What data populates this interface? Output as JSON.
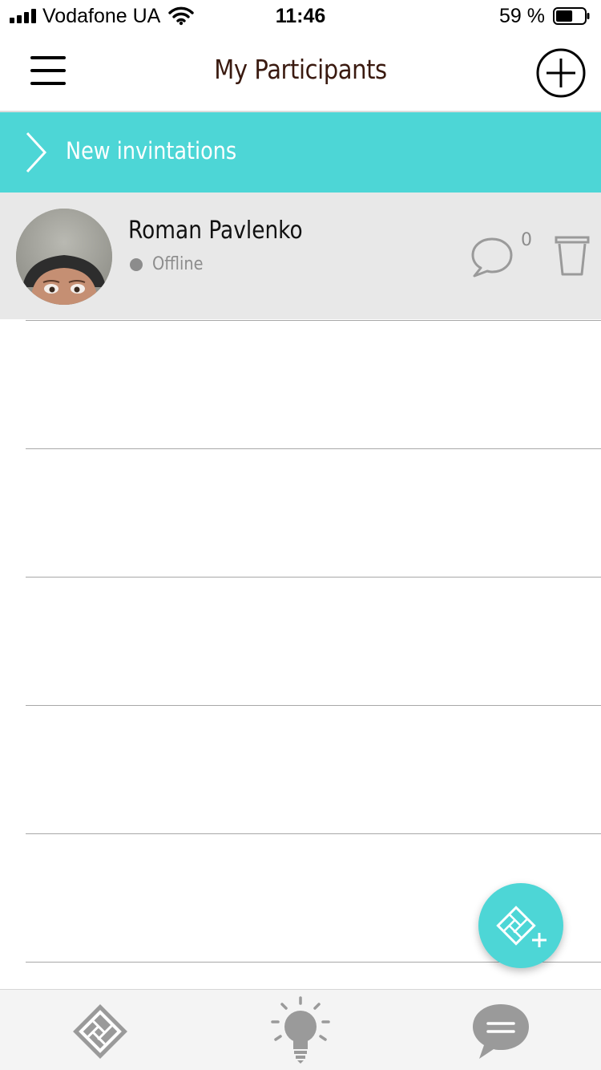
{
  "status_bar": {
    "carrier": "Vodafone UA",
    "time": "11:46",
    "battery_percent": "59 %",
    "battery_level": 0.59,
    "icons": [
      "signal-icon",
      "wifi-icon",
      "battery-icon"
    ]
  },
  "header": {
    "title": "My Participants",
    "menu_icon": "hamburger-menu-icon",
    "add_icon": "plus-circle-icon"
  },
  "invitations": {
    "label": "New invintations",
    "icon": "chevron-right-icon"
  },
  "participants": [
    {
      "name": "Roman Pavlenko",
      "status": "Offline",
      "message_count": "0",
      "icons": [
        "avatar",
        "chat-bubble-icon",
        "trash-icon"
      ]
    }
  ],
  "colors": {
    "accent": "#4dd6d6",
    "title": "#3a1a10",
    "row_background": "#e8e8e8",
    "muted": "#8c8c8c"
  },
  "fab": {
    "icon": "add-floorplan-icon"
  },
  "tabbar": {
    "items": [
      {
        "icon": "floorplan-icon"
      },
      {
        "icon": "lightbulb-icon"
      },
      {
        "icon": "chat-icon"
      }
    ]
  }
}
